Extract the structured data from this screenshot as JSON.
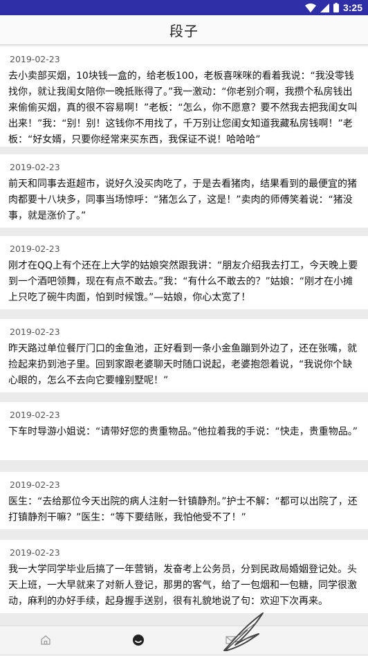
{
  "status_bar": {
    "time": "3:25"
  },
  "header": {
    "title": "段子"
  },
  "posts": [
    {
      "date": "2019-02-23",
      "text": "去小卖部买烟，10块钱一盒的，给老板100，老板喜咪咪的看着我说：“我没零钱找你，就让我闺女陪你一晚抵账得了。”我一激动：“你老别介啊，我攒个私房钱出来偷偷买烟，真的很不容易啊！”老板：“怎么，你不愿意？要不然我去把我闺女叫出来！”我：“别！别！这钱你不用找了，千万别让您闺女知道我藏私房钱啊！”老板：“好女婿，只要你经常来买东西，我保证不说！哈哈哈”"
    },
    {
      "date": "2019-02-23",
      "text": "前天和同事去逛超市，说好久没买肉吃了，于是去看猪肉，结果看到的最便宜的猪肉都要十八块多，同事当场惊呼：“猪怎么了，这是！”卖肉的师傅笑着说：“猪没事，就是涨价了。”"
    },
    {
      "date": "2019-02-23",
      "text": "刚才在QQ上有个还在上大学的姑娘突然跟我讲：“朋友介绍我去打工，今天晚上要到一个酒吧领舞，现在有点不敢去。”我：“有什么不敢去的？”姑娘：“刚才在小摊上只吃了碗牛肉面，怕到时候饿。”—姑娘，你心太宽了！"
    },
    {
      "date": "2019-02-23",
      "text": "昨天路过单位餐厅门口的金鱼池，正好看到一条小金鱼蹦到外边了，还在张嘴，就捡起来扔到池子里。回到家跟老婆聊天时随口说起，老婆抱怨着说，“我说你个缺心眼的，怎么不去向它要幢别墅呢！”"
    },
    {
      "date": "2019-02-23",
      "text": "下车时导游小姐说：“请带好您的贵重物品。”他拉着我的手说：“快走，贵重物品。”"
    },
    {
      "date": "2019-02-23",
      "text": "医生：“去给那位今天出院的病人注射一针镇静剂。”护士不解：“都可以出院了，还打镇静剂干嘛？”医生：“等下要结账，我怕他受不了！”"
    },
    {
      "date": "2019-02-23",
      "text": "我一大学同学毕业后搞了一年营销，发奋考上公务员，分到民政局婚姻登记处。头天上班，一大早就来了对新人登记，那男的客气，给了一包烟和一包糖，同学很激动，麻利的办好手续，起身握手送别，很有礼貌地说了句：欢迎下次再来。"
    }
  ],
  "tabs": [
    {
      "icon": "home-icon"
    },
    {
      "icon": "joke-icon"
    },
    {
      "icon": "mail-icon"
    }
  ],
  "fab_icon": "quill-icon"
}
